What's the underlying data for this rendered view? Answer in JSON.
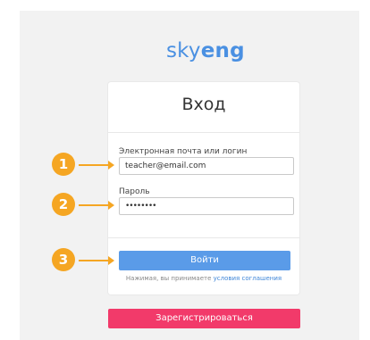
{
  "brand": {
    "logo_light": "sky",
    "logo_bold": "eng",
    "logo_color": "#4a90e2"
  },
  "login_card": {
    "title": "Вход",
    "email_label": "Электронная почта или логин",
    "email_value": "teacher@email.com",
    "password_label": "Пароль",
    "password_value": "••••••••",
    "login_button": "Войти",
    "terms_prefix": "Нажимая, вы принимаете ",
    "terms_link": "условия соглашения"
  },
  "register_button": "Зарегистрироваться",
  "annotations": {
    "step_1": "1",
    "step_2": "2",
    "step_3": "3",
    "color": "#f5a623"
  },
  "colors": {
    "login_button": "#5a9be8",
    "register_button": "#f23a6a"
  }
}
